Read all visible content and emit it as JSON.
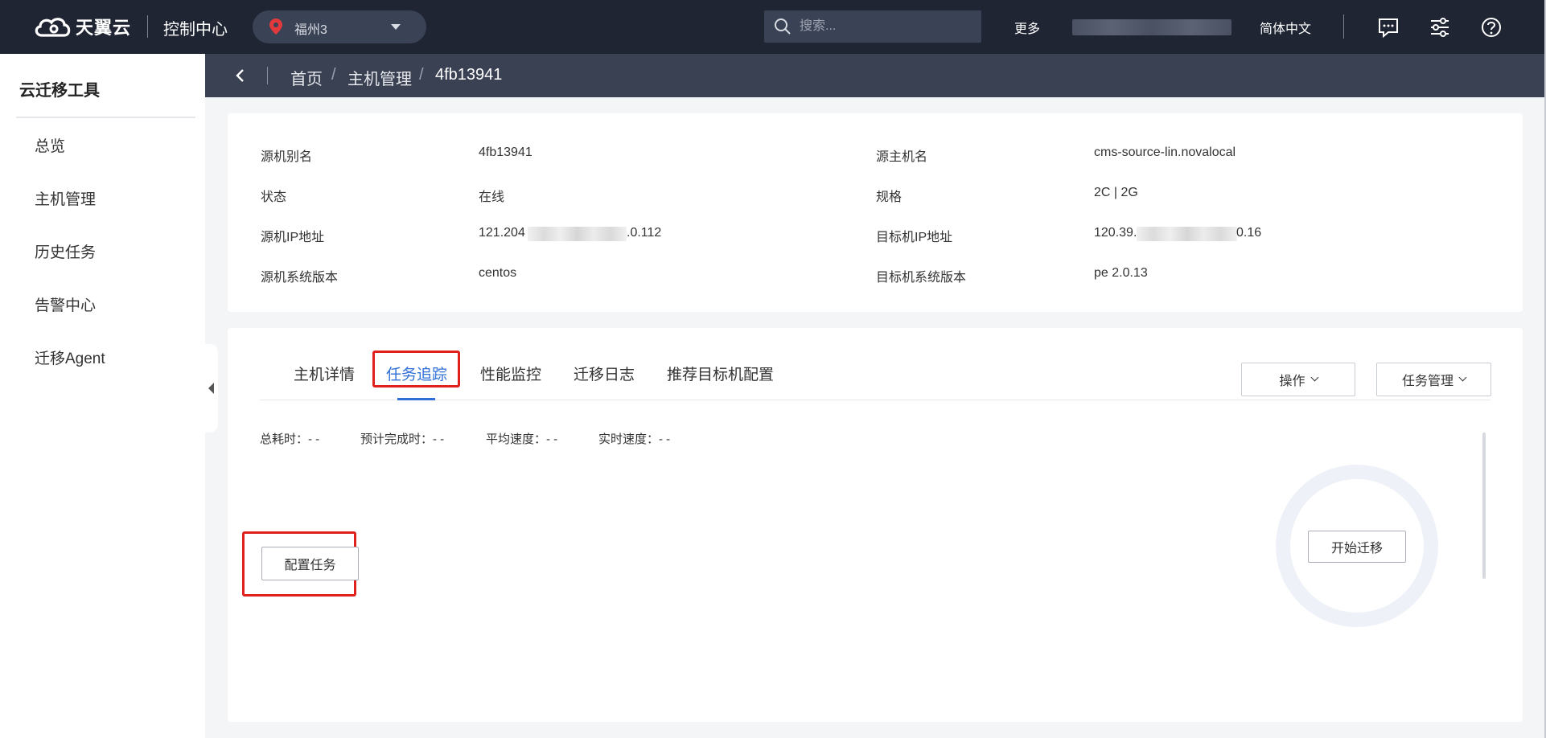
{
  "topbar": {
    "brand": "天翼云",
    "console_title": "控制中心",
    "region": "福州3",
    "search_placeholder": "搜索...",
    "more": "更多",
    "language": "简体中文",
    "icons": [
      "message-icon",
      "settings-sliders-icon",
      "help-icon"
    ]
  },
  "sidebar": {
    "title": "云迁移工具",
    "items": [
      {
        "label": "总览"
      },
      {
        "label": "主机管理"
      },
      {
        "label": "历史任务"
      },
      {
        "label": "告警中心"
      },
      {
        "label": "迁移Agent"
      }
    ]
  },
  "breadcrumb": {
    "items": [
      "首页",
      "主机管理",
      "4fb13941"
    ],
    "separator": "/"
  },
  "host_info": {
    "left": [
      {
        "label": "源机别名",
        "value": "4fb13941"
      },
      {
        "label": "状态",
        "value": "在线"
      },
      {
        "label": "源机IP地址",
        "value_prefix": "121.204",
        "value_suffix": ".0.112"
      },
      {
        "label": "源机系统版本",
        "value": "centos"
      }
    ],
    "right": [
      {
        "label": "源主机名",
        "value": "cms-source-lin.novalocal"
      },
      {
        "label": "规格",
        "value": "2C | 2G"
      },
      {
        "label": "目标机IP地址",
        "value_prefix": "120.39.",
        "value_suffix": "0.16"
      },
      {
        "label": "目标机系统版本",
        "value": "pe 2.0.13"
      }
    ]
  },
  "tabs": {
    "items": [
      {
        "label": "主机详情"
      },
      {
        "label": "任务追踪",
        "active": true
      },
      {
        "label": "性能监控"
      },
      {
        "label": "迁移日志"
      },
      {
        "label": "推荐目标机配置"
      }
    ],
    "operations_button": "操作",
    "task_management_button": "任务管理"
  },
  "task_tracking": {
    "stats": [
      {
        "label": "总耗时：",
        "value": "- -"
      },
      {
        "label": "预计完成时：",
        "value": "- -"
      },
      {
        "label": "平均速度：",
        "value": "- -"
      },
      {
        "label": "实时速度：",
        "value": "- -"
      }
    ],
    "configure_button": "配置任务",
    "start_button": "开始迁移"
  },
  "colors": {
    "topbar_bg": "#1f2533",
    "breadcrumb_bg": "#3a4153",
    "accent": "#2f6fd6",
    "highlight": "#e0201c",
    "region_pin": "#e2393c"
  }
}
